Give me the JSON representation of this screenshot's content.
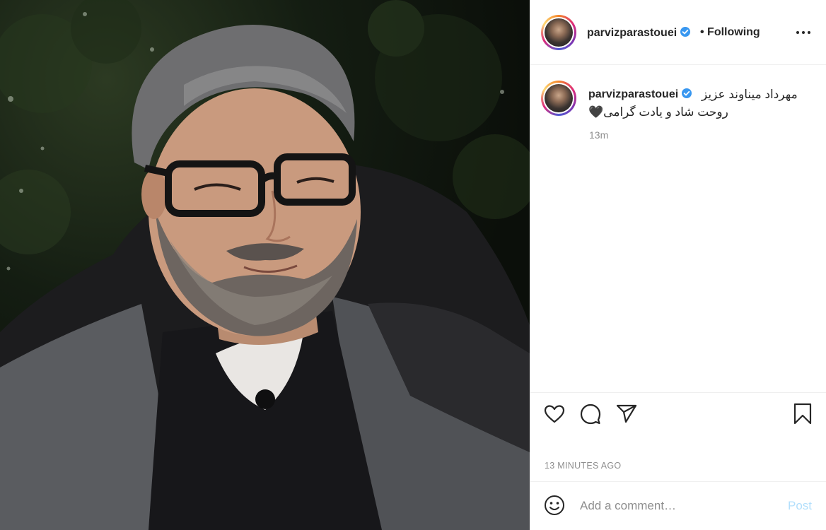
{
  "post": {
    "username": "parvizparastouei",
    "following_label": "• Following",
    "caption_line1": "مهرداد میناوند عزیز",
    "caption_line2": "روحت شاد و یادت گرامی🖤",
    "caption_time": "13m",
    "time_ago": "13 MINUTES AGO"
  },
  "comment": {
    "placeholder": "Add a comment…",
    "post_label": "Post"
  },
  "icons": {
    "more": "more-horizontal-icon",
    "like": "heart-icon",
    "comment": "comment-bubble-icon",
    "share": "paper-plane-icon",
    "save": "bookmark-icon",
    "emoji": "smiley-icon",
    "verified": "verified-badge-icon"
  },
  "colors": {
    "verified_blue": "#3897f0",
    "post_button_disabled": "#b2dffc",
    "secondary_text": "#8e8e8e"
  }
}
